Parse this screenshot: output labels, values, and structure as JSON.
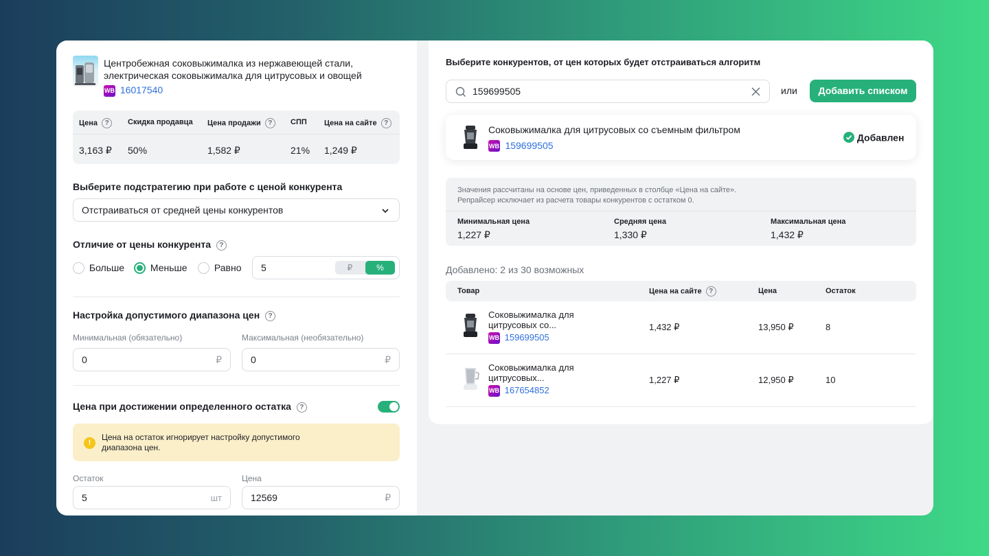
{
  "product": {
    "title_line1": "Центробежная соковыжималка из нержавеющей стали,",
    "title_line2": "электрическая соковыжималка для цитрусовых и овощей",
    "marketplace_badge": "WB",
    "sku": "16017540"
  },
  "price_table": {
    "headers": [
      "Цена",
      "Скидка продавца",
      "Цена продажи",
      "СПП",
      "Цена на сайте"
    ],
    "values": [
      "3,163 ₽",
      "50%",
      "1,582 ₽",
      "21%",
      "1,249 ₽"
    ]
  },
  "substrategy": {
    "label": "Выберите подстратегию при работе с ценой конкурента",
    "selected": "Отстраиваться от средней цены конкурентов"
  },
  "difference": {
    "label": "Отличие от цены конкурента",
    "options": [
      "Больше",
      "Меньше",
      "Равно"
    ],
    "selected": "Меньше",
    "value": "5",
    "unit_rub": "₽",
    "unit_pct": "%"
  },
  "range": {
    "label": "Настройка допустимого диапазона цен",
    "min_label": "Минимальная (обязательно)",
    "max_label": "Максимальная (необязательно)",
    "min_value": "0",
    "max_value": "0",
    "currency": "₽"
  },
  "stock_price": {
    "label": "Цена при достижении определенного остатка",
    "enabled": true,
    "warning_line1": "Цена на остаток игнорирует настройку допустимого",
    "warning_line2": "диапазона цен.",
    "stock_label": "Остаток",
    "stock_value": "5",
    "stock_unit": "шт",
    "price_label": "Цена",
    "price_value": "12569",
    "price_unit": "₽"
  },
  "competitors": {
    "heading": "Выберите конкурентов, от цен которых будет отстраиваться алгоритм",
    "search_value": "159699505",
    "or_label": "или",
    "add_list_button": "Добавить списком",
    "result": {
      "name": "Соковыжималка для цитрусовых со съемным фильтром",
      "sku": "159699505",
      "status": "Добавлен"
    },
    "info_line1": "Значения рассчитаны на основе цен, приведенных в столбце «Цена на сайте».",
    "info_line2": "Репрайсер исключает из расчета товары конкурентов с остатком 0.",
    "stats": [
      {
        "label": "Минимальная цена",
        "value": "1,227 ₽"
      },
      {
        "label": "Средняя цена",
        "value": "1,330 ₽"
      },
      {
        "label": "Максимальная цена",
        "value": "1,432 ₽"
      }
    ],
    "added_label": "Добавлено: 2 из 30 возможных",
    "table_headers": [
      "Товар",
      "Цена на сайте",
      "Цена",
      "Остаток"
    ],
    "rows": [
      {
        "name_line1": "Соковыжималка для",
        "name_line2": "цитрусовых со...",
        "sku": "159699505",
        "site_price": "1,432 ₽",
        "price": "13,950 ₽",
        "stock": "8"
      },
      {
        "name_line1": "Соковыжималка для",
        "name_line2": "цитрусовых...",
        "sku": "167654852",
        "site_price": "1,227 ₽",
        "price": "12,950 ₽",
        "stock": "10"
      }
    ]
  },
  "colors": {
    "accent": "#27b07a",
    "link": "#2e6fdc",
    "warning_bg": "#fbefc9",
    "warning_icon": "#f5c518"
  }
}
